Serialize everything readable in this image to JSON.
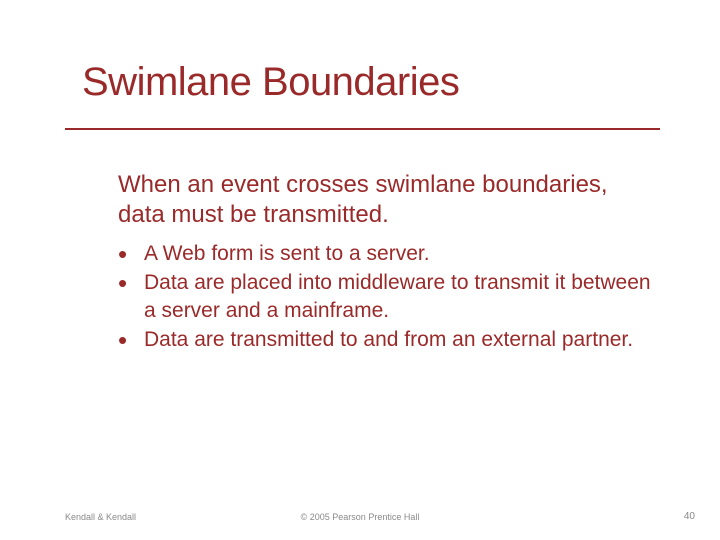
{
  "title": "Swimlane Boundaries",
  "lead": "When an event crosses swimlane boundaries, data must be transmitted.",
  "bullets": [
    "A Web form is sent to a server.",
    "Data are placed into middleware to transmit it between a server and a mainframe.",
    "Data are transmitted to and from an external partner."
  ],
  "footer": {
    "left": "Kendall & Kendall",
    "center": "© 2005 Pearson Prentice Hall",
    "pageNumber": "40"
  }
}
